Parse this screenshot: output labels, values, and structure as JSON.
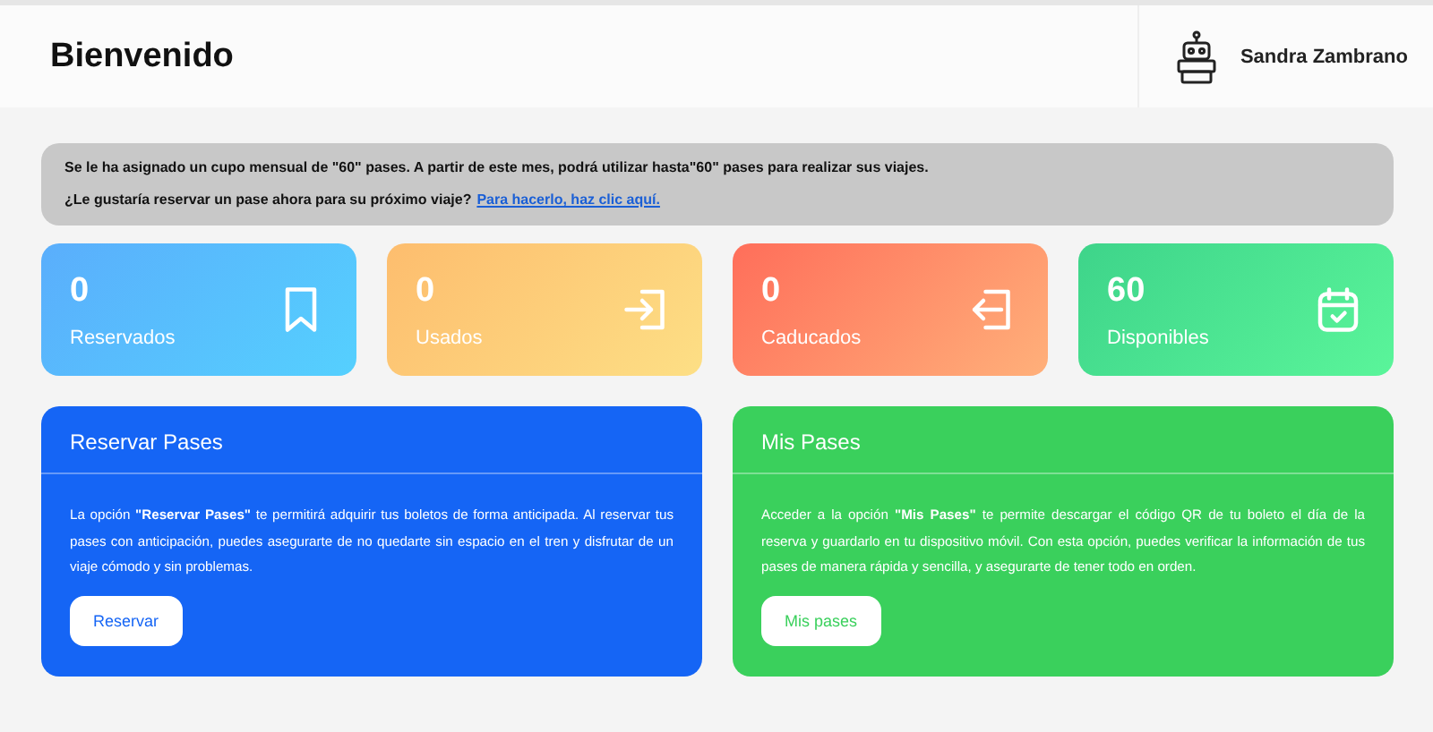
{
  "header": {
    "title": "Bienvenido",
    "user_name": "Sandra Zambrano"
  },
  "notice": {
    "line_1": "Se le ha asignado un cupo mensual de \"60\" pases. A partir de este mes, podrá utilizar hasta\"60\" pases para realizar sus viajes.",
    "line_2": "¿Le gustaría reservar un pase ahora para su próximo viaje?",
    "link": "Para hacerlo, haz clic aquí."
  },
  "stats": [
    {
      "kind": "reserved",
      "value": "0",
      "label": "Reservados"
    },
    {
      "kind": "used",
      "value": "0",
      "label": "Usados"
    },
    {
      "kind": "expired",
      "value": "0",
      "label": "Caducados"
    },
    {
      "kind": "available",
      "value": "60",
      "label": "Disponibles"
    }
  ],
  "panels": [
    {
      "title": "Reservar Pases",
      "color": "#1565f5",
      "text": "La opción **\"Reservar Pases\"** te permitirá adquirir tus boletos de forma anticipada. Al reservar tus pases con anticipación, puedes asegurarte de no quedarte sin espacio en el tren y disfrutar de un viaje cómodo y sin problemas.",
      "button": "Reservar"
    },
    {
      "title": "Mis Pases",
      "color": "#3ad05c",
      "text": "Acceder a la opción **\"Mis Pases\"** te permite descargar el código QR de tu boleto el día de la reserva y guardarlo en tu dispositivo móvil. Con esta opción, puedes verificar la información de tus pases de manera rápida y sencilla, y asegurarte de tener todo en orden.",
      "button": "Mis pases"
    }
  ]
}
